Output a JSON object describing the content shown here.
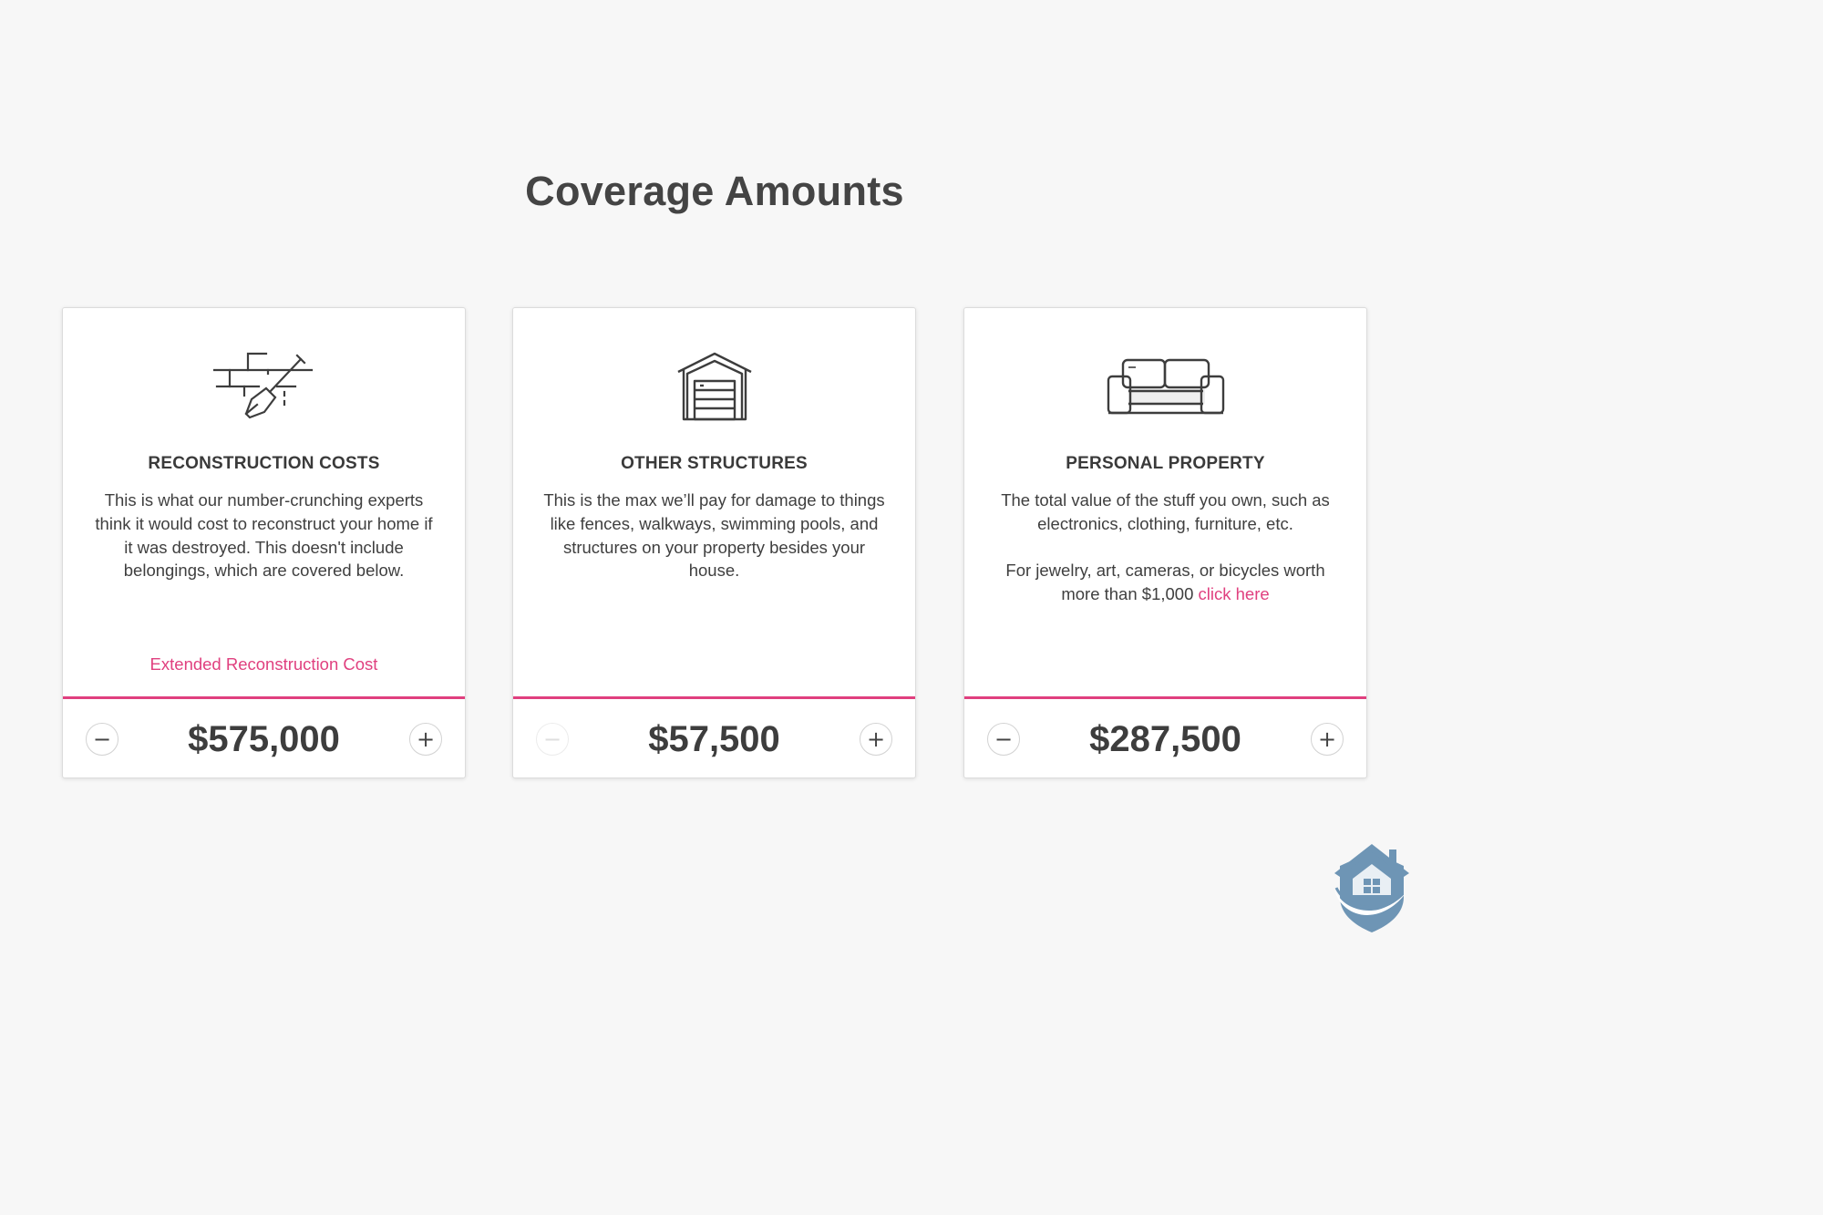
{
  "page": {
    "title": "Coverage Amounts"
  },
  "colors": {
    "accent": "#e0407f",
    "background": "#f7f7f7",
    "card": "#ffffff",
    "text": "#3f3f3f",
    "logo": "#6e95b5"
  },
  "cards": [
    {
      "icon": "brick-wall-trowel-icon",
      "heading": "RECONSTRUCTION COSTS",
      "paragraphs": [
        "This is what our number-crunching experts think it would cost to reconstruct your home if it was destroyed. This doesn't include belongings, which are covered below."
      ],
      "link": "Extended Reconstruction Cost",
      "amount": "$575,000",
      "decrement": "−",
      "increment": "+",
      "decrement_enabled": true,
      "increment_enabled": true
    },
    {
      "icon": "garage-icon",
      "heading": "OTHER STRUCTURES",
      "paragraphs": [
        "This is the max we’ll pay for damage to things like fences, walkways, swimming pools, and structures on your property besides your house."
      ],
      "amount": "$57,500",
      "decrement": "−",
      "increment": "+",
      "decrement_enabled": false,
      "increment_enabled": true
    },
    {
      "icon": "sofa-icon",
      "heading": "PERSONAL PROPERTY",
      "paragraphs": [
        "The total value of the stuff you own, such as electronics, clothing, furniture, etc.",
        "For jewelry, art, cameras, or bicycles worth more than $1,000"
      ],
      "inline_link": "click here",
      "amount": "$287,500",
      "decrement": "−",
      "increment": "+",
      "decrement_enabled": true,
      "increment_enabled": true
    }
  ],
  "logo": {
    "icon": "house-shield-logo"
  }
}
